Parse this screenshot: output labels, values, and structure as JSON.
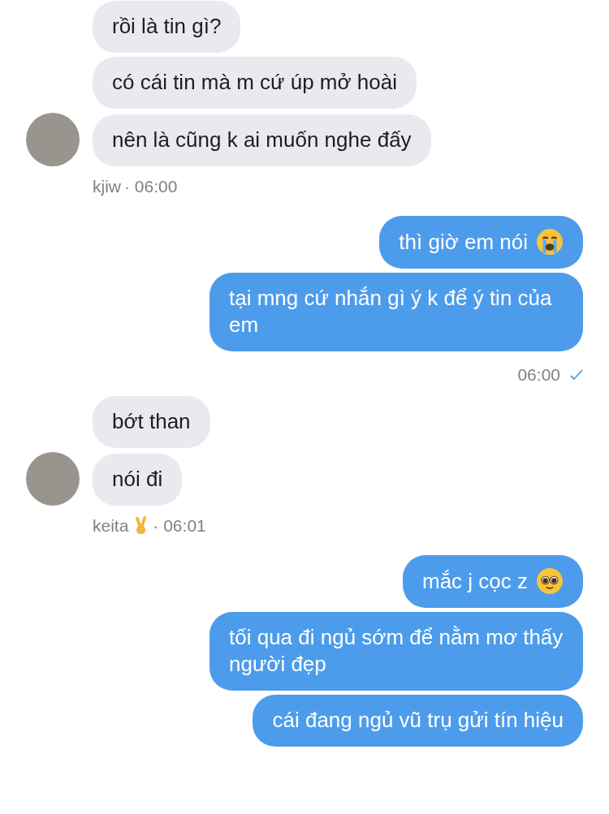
{
  "groups": [
    {
      "kind": "incoming",
      "messages": [
        {
          "kind": "plain",
          "text": "rồi là tin gì?"
        },
        {
          "kind": "plain",
          "text": "có cái tin mà m cứ úp mở hoài"
        },
        {
          "kind": "plain",
          "text": "nên là cũng k ai muốn nghe đấy"
        }
      ],
      "sender": {
        "kind": "plain",
        "name": "kjiw"
      },
      "time": "· 06:00"
    },
    {
      "kind": "outgoing",
      "messages": [
        {
          "kind": "crying",
          "text": "thì giờ em nói"
        },
        {
          "kind": "plain",
          "text": "tại mng cứ nhắn gì ý k để ý tin của em"
        }
      ],
      "time": "06:00",
      "read": true
    },
    {
      "kind": "incoming",
      "messages": [
        {
          "kind": "plain",
          "text": "bớt than"
        },
        {
          "kind": "plain",
          "text": "nói đi"
        }
      ],
      "sender": {
        "kind": "victory",
        "name": "keita"
      },
      "time": "· 06:01"
    },
    {
      "kind": "outgoing",
      "messages": [
        {
          "kind": "pleading",
          "text": "mắc j cọc z"
        },
        {
          "kind": "plain",
          "text": "tối qua đi ngủ sớm để nằm mơ thấy người đẹp"
        },
        {
          "kind": "plain",
          "text": "cái đang ngủ vũ trụ gửi tín hiệu"
        }
      ]
    }
  ]
}
